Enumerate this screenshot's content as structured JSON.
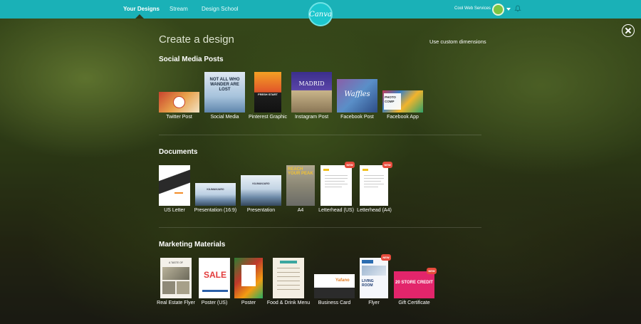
{
  "topbar": {
    "nav": [
      "Your Designs",
      "Stream",
      "Design School"
    ],
    "logo": "Canva",
    "account": "Cool Web Services",
    "bell_icon": "bell-icon"
  },
  "page": {
    "title": "Create a design",
    "custom_dimensions": "Use custom dimensions"
  },
  "sections": [
    {
      "title": "Social Media Posts",
      "items": [
        {
          "label": "Twitter Post",
          "new": false
        },
        {
          "label": "Social Media",
          "new": false,
          "thumb_text": "NOT ALL WHO WANDER ARE LOST"
        },
        {
          "label": "Pinterest Graphic",
          "new": false,
          "thumb_text": "FRESH START"
        },
        {
          "label": "Instagram Post",
          "new": false,
          "thumb_text": "MADRID"
        },
        {
          "label": "Facebook Post",
          "new": false,
          "thumb_text": "Waffles"
        },
        {
          "label": "Facebook App",
          "new": false,
          "thumb_text": "PHOTO COMP"
        }
      ]
    },
    {
      "title": "Documents",
      "items": [
        {
          "label": "US Letter",
          "new": false
        },
        {
          "label": "Presentation (16:9)",
          "new": false,
          "thumb_text": "KILIMANJARO"
        },
        {
          "label": "Presentation",
          "new": false,
          "thumb_text": "KILIMANJARO"
        },
        {
          "label": "A4",
          "new": false,
          "thumb_text": "REACH YOUR PEAK"
        },
        {
          "label": "Letterhead (US)",
          "new": true
        },
        {
          "label": "Letterhead (A4)",
          "new": true
        }
      ]
    },
    {
      "title": "Marketing Materials",
      "items": [
        {
          "label": "Real Estate Flyer",
          "new": false,
          "thumb_text": "A TASTE OF"
        },
        {
          "label": "Poster (US)",
          "new": false,
          "thumb_text": "SALE"
        },
        {
          "label": "Poster",
          "new": false
        },
        {
          "label": "Food & Drink Menu",
          "new": false
        },
        {
          "label": "Business Card",
          "new": false,
          "thumb_text": "Yafano"
        },
        {
          "label": "Flyer",
          "new": true,
          "thumb_text": "LIVING ROOM"
        },
        {
          "label": "Gift Certificate",
          "new": true,
          "thumb_text": "20 STORE CREDIT"
        }
      ]
    }
  ],
  "new_label": "NEW"
}
